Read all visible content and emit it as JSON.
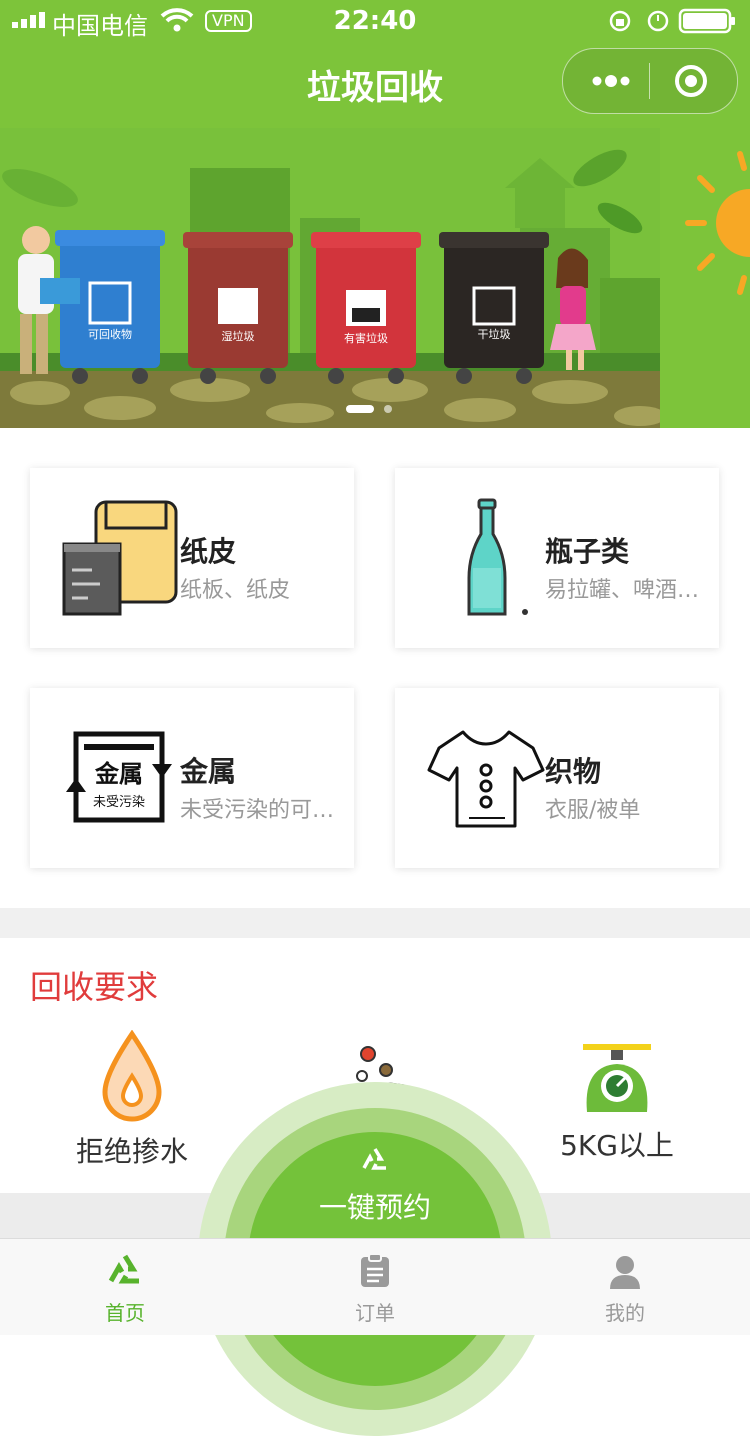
{
  "status_bar": {
    "carrier": "中国电信",
    "vpn": "VPN",
    "time": "22:40"
  },
  "header": {
    "title": "垃圾回收"
  },
  "banner": {
    "bin_labels": [
      "可回收物",
      "湿垃圾",
      "有害垃圾",
      "干垃圾"
    ],
    "colors": {
      "blue_bin": "#2f7fd0",
      "brown_bin": "#9a3a32",
      "red_bin": "#d2343c",
      "black_bin": "#2b2623"
    }
  },
  "categories": [
    {
      "title": "纸皮",
      "subtitle": "纸板、纸皮",
      "icon": "paper-box-icon"
    },
    {
      "title": "瓶子类",
      "subtitle": "易拉罐、啤酒…",
      "icon": "bottle-icon"
    },
    {
      "title": "金属",
      "subtitle": "未受污染的可…",
      "icon": "metal-icon",
      "icon_text_top": "金属",
      "icon_text_bottom": "未受污染"
    },
    {
      "title": "织物",
      "subtitle": "衣服/被单",
      "icon": "tshirt-icon"
    }
  ],
  "requirements": {
    "title": "回收要求",
    "items": [
      {
        "label": "拒绝掺水",
        "icon": "water-drop-icon"
      },
      {
        "label": "",
        "icon": "clean-dirt-icon"
      },
      {
        "label": "5KG以上",
        "icon": "scale-icon"
      }
    ]
  },
  "appointment": {
    "label": "一键预约"
  },
  "tabbar": {
    "items": [
      {
        "label": "首页",
        "icon": "recycle-icon",
        "active": true
      },
      {
        "label": "订单",
        "icon": "clipboard-icon",
        "active": false
      },
      {
        "label": "我的",
        "icon": "user-icon",
        "active": false
      }
    ]
  },
  "colors": {
    "primary_green": "#7dc43a",
    "accent_red": "#e03c3c",
    "tab_active": "#58b32d"
  }
}
